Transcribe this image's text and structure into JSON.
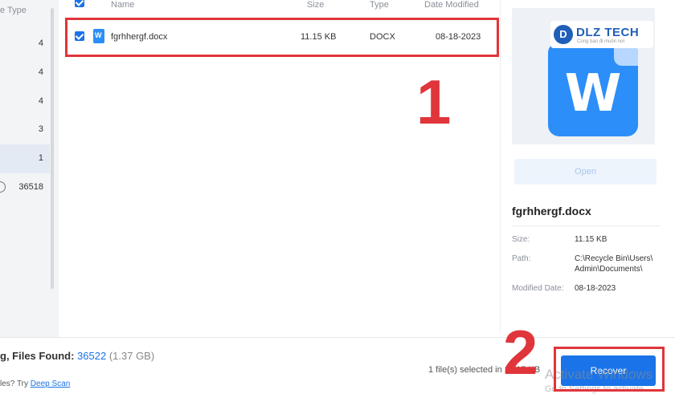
{
  "sidebar": {
    "header": "e Type",
    "items": [
      {
        "count": "4"
      },
      {
        "count": "4"
      },
      {
        "count": "4"
      },
      {
        "count": "3"
      },
      {
        "count": "1"
      },
      {
        "count": "36518"
      }
    ]
  },
  "list": {
    "columns": {
      "name": "Name",
      "size": "Size",
      "type": "Type",
      "date": "Date Modified"
    },
    "rows": [
      {
        "name": "fgrhhergf.docx",
        "size": "11.15 KB",
        "type": "DOCX",
        "date": "08-18-2023",
        "checked": true
      }
    ]
  },
  "annotations": {
    "step1": "1",
    "step2": "2"
  },
  "preview": {
    "brand_name": "DLZ TECH",
    "brand_logo": "D",
    "brand_tagline": "Cùng bạn đi muôn nơi",
    "icon_letter": "W",
    "open_label": "Open",
    "file_name": "fgrhhergf.docx",
    "size_label": "Size:",
    "size_value": "11.15 KB",
    "path_label": "Path:",
    "path_line1": "C:\\Recycle Bin\\Users\\",
    "path_line2": "Admin\\Documents\\",
    "modified_label": "Modified Date:",
    "modified_value": "08-18-2023"
  },
  "footer": {
    "status_prefix": "g, Files Found: ",
    "files_found": "36522",
    "files_size": "(1.37 GB)",
    "deep_prefix": "les? Try ",
    "deep_link": "Deep Scan",
    "selection_info": "1 file(s) selected in 11.15 KB",
    "recover_label": "Recover",
    "watermark_line1": "Activate Windows",
    "watermark_line2": "Go to Settings to activate"
  },
  "colors": {
    "accent": "#1a73e8",
    "highlight": "#e0353a"
  }
}
